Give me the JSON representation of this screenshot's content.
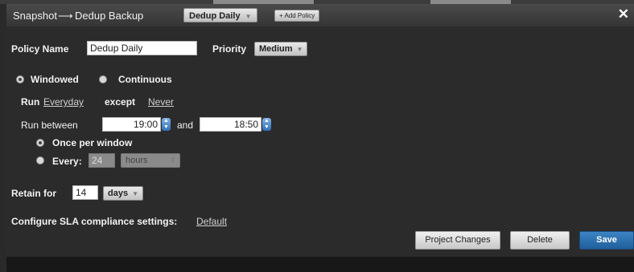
{
  "header": {
    "crumb_snapshot": "Snapshot",
    "crumb_arrow": "⟶",
    "crumb_dedup": "Dedup Backup",
    "policy_tab": "Dedup Daily",
    "add_policy": "+ Add Policy",
    "close": "✕"
  },
  "policy": {
    "name_label": "Policy Name",
    "name_value": "Dedup Daily",
    "priority_label": "Priority",
    "priority_value": "Medium"
  },
  "mode": {
    "windowed_label": "Windowed",
    "continuous_label": "Continuous",
    "selected": "Windowed"
  },
  "schedule": {
    "run_label": "Run",
    "run_days": "Everyday",
    "except_label": "except",
    "except_days": "Never",
    "between_label": "Run between",
    "start_time": "19:00",
    "and_label": "and",
    "end_time": "18:50",
    "once_label": "Once per window",
    "every_label": "Every:",
    "every_value": "24",
    "every_unit": "hours",
    "frequency_selected": "Once per window"
  },
  "retain": {
    "label": "Retain for",
    "value": "14",
    "unit": "days"
  },
  "sla": {
    "label": "Configure SLA compliance settings:",
    "link": "Default"
  },
  "buttons": {
    "project_changes": "Project Changes",
    "delete": "Delete",
    "save": "Save"
  },
  "icons": {
    "caret": "chevron-down-icon",
    "spinner": "spinner-updown-icon",
    "close": "close-icon"
  },
  "colors": {
    "accent": "#2f6fb6",
    "save_button": "#2a6fb0"
  }
}
